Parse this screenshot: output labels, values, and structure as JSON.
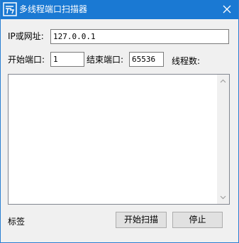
{
  "window": {
    "title": "多线程端口扫描器",
    "close_glyph": "✕",
    "accent_color": "#1a79d3",
    "icon": "app-logo-icon"
  },
  "form": {
    "ip_label": "IP或网址:",
    "ip_value": "127.0.0.1",
    "start_port_label": "开始端口:",
    "start_port_value": "1",
    "end_port_label": "结束端口:",
    "end_port_value": "65536",
    "thread_count_label": "线程数:"
  },
  "output": {
    "text": ""
  },
  "footer": {
    "status_label": "标签",
    "start_button": "开始扫描",
    "stop_button": "停止"
  }
}
